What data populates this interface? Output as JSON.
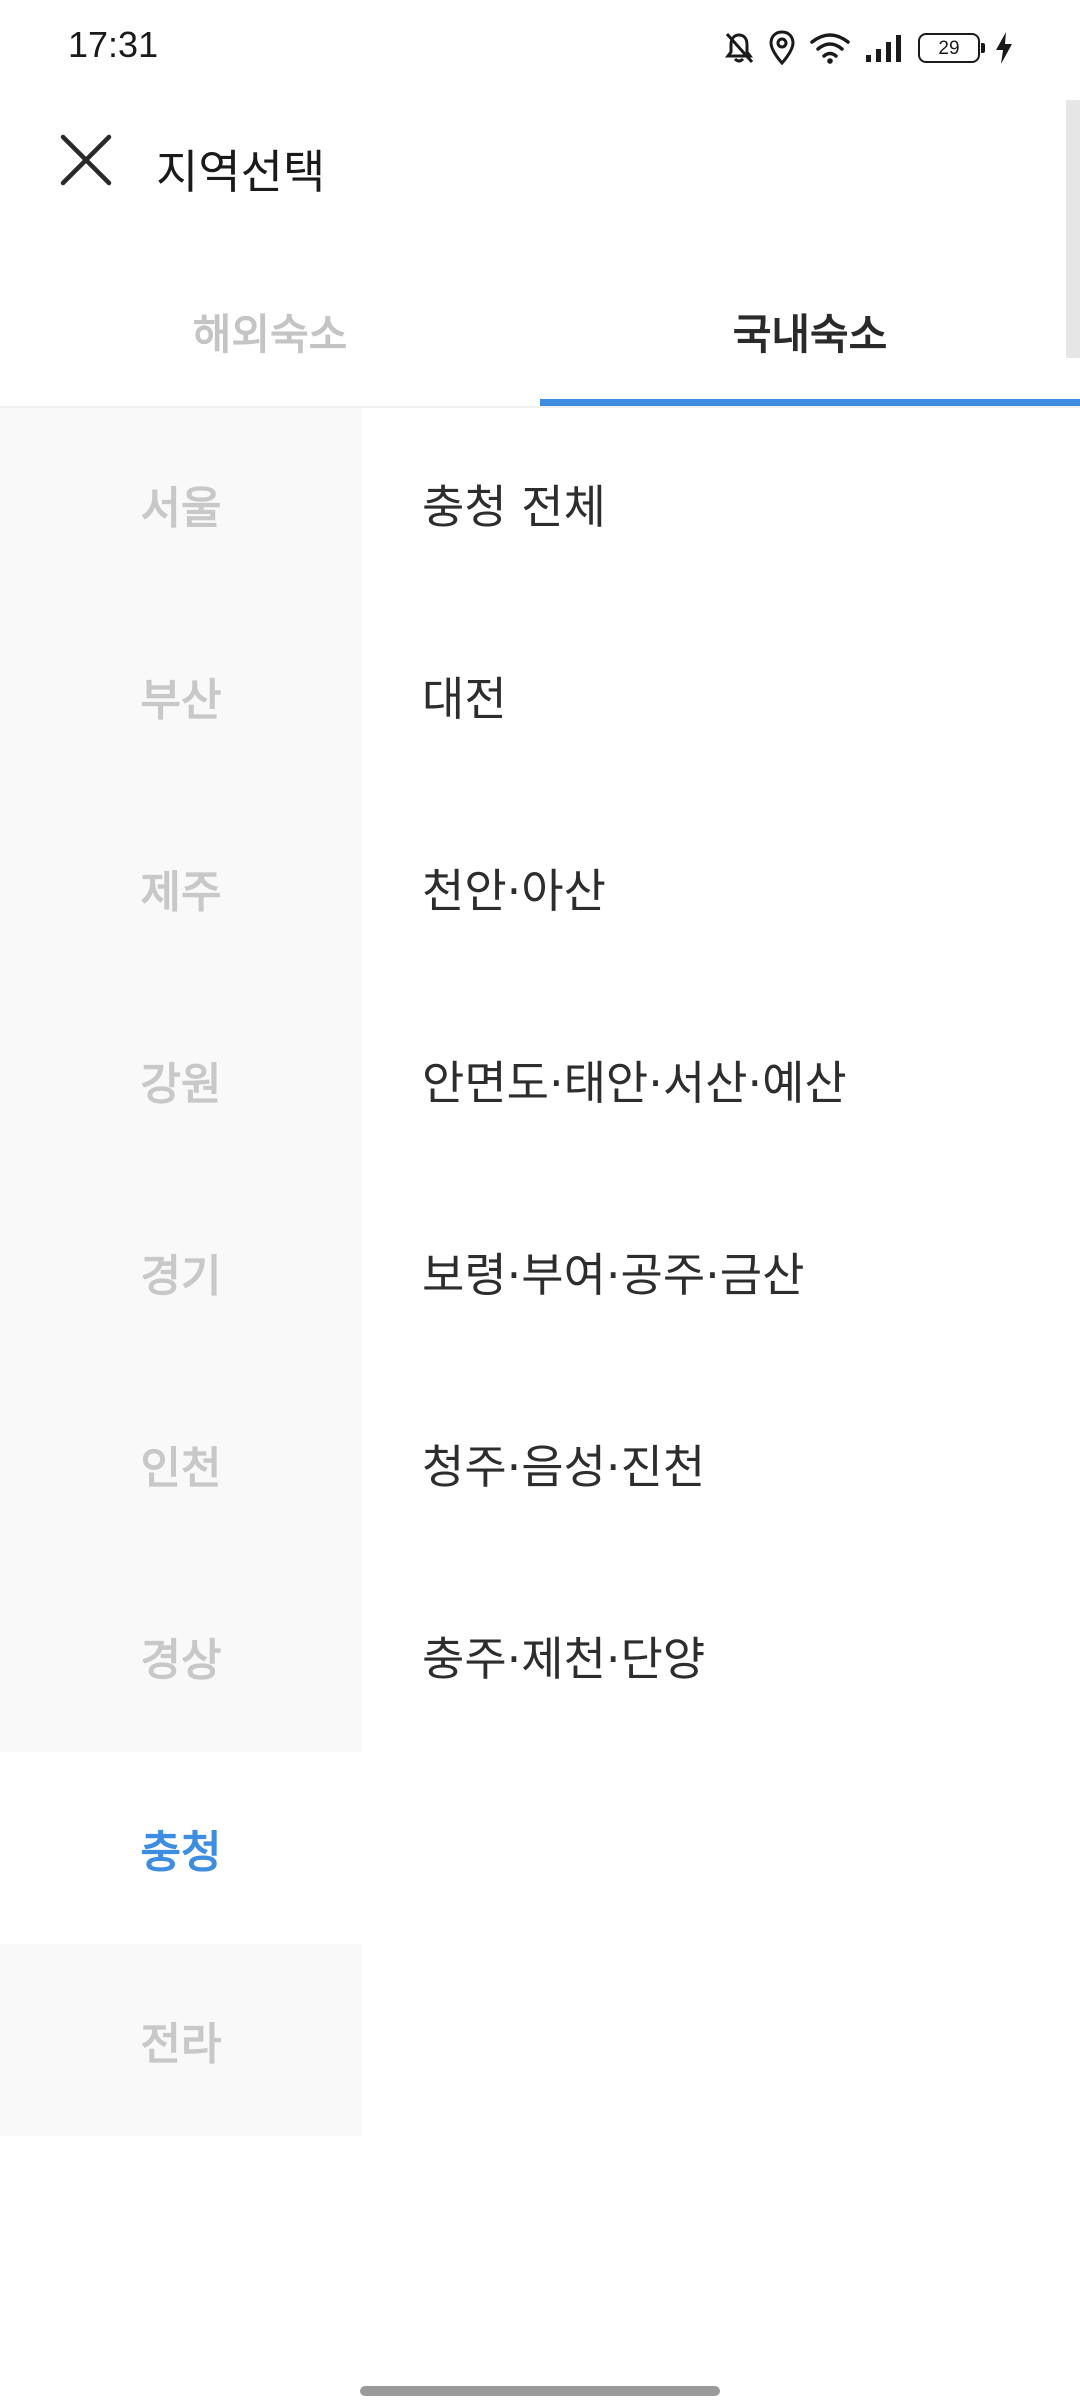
{
  "status_bar": {
    "time": "17:31",
    "battery": "29",
    "icons": [
      "mute-bell-icon",
      "location-icon",
      "wifi-icon",
      "signal-icon",
      "battery-icon",
      "charging-icon"
    ]
  },
  "header": {
    "title": "지역선택",
    "close_icon": "close-icon"
  },
  "tabs": [
    {
      "label": "해외숙소",
      "active": false
    },
    {
      "label": "국내숙소",
      "active": true
    }
  ],
  "regions": [
    {
      "label": "서울"
    },
    {
      "label": "부산"
    },
    {
      "label": "제주"
    },
    {
      "label": "강원"
    },
    {
      "label": "경기"
    },
    {
      "label": "인천"
    },
    {
      "label": "경상"
    },
    {
      "label": "충청"
    },
    {
      "label": "전라"
    }
  ],
  "selected_region": "충청",
  "subregions": [
    {
      "label": "충청 전체"
    },
    {
      "label": "대전"
    },
    {
      "label": "천안·아산"
    },
    {
      "label": "안면도·태안·서산·예산"
    },
    {
      "label": "보령·부여·공주·금산"
    },
    {
      "label": "청주·음성·진천"
    },
    {
      "label": "충주·제천·단양"
    }
  ],
  "colors": {
    "accent": "#3d8de0",
    "inactive_text": "#c8c8c8",
    "sidebar_bg": "#f9f9f9",
    "text": "#2d2d2d"
  }
}
